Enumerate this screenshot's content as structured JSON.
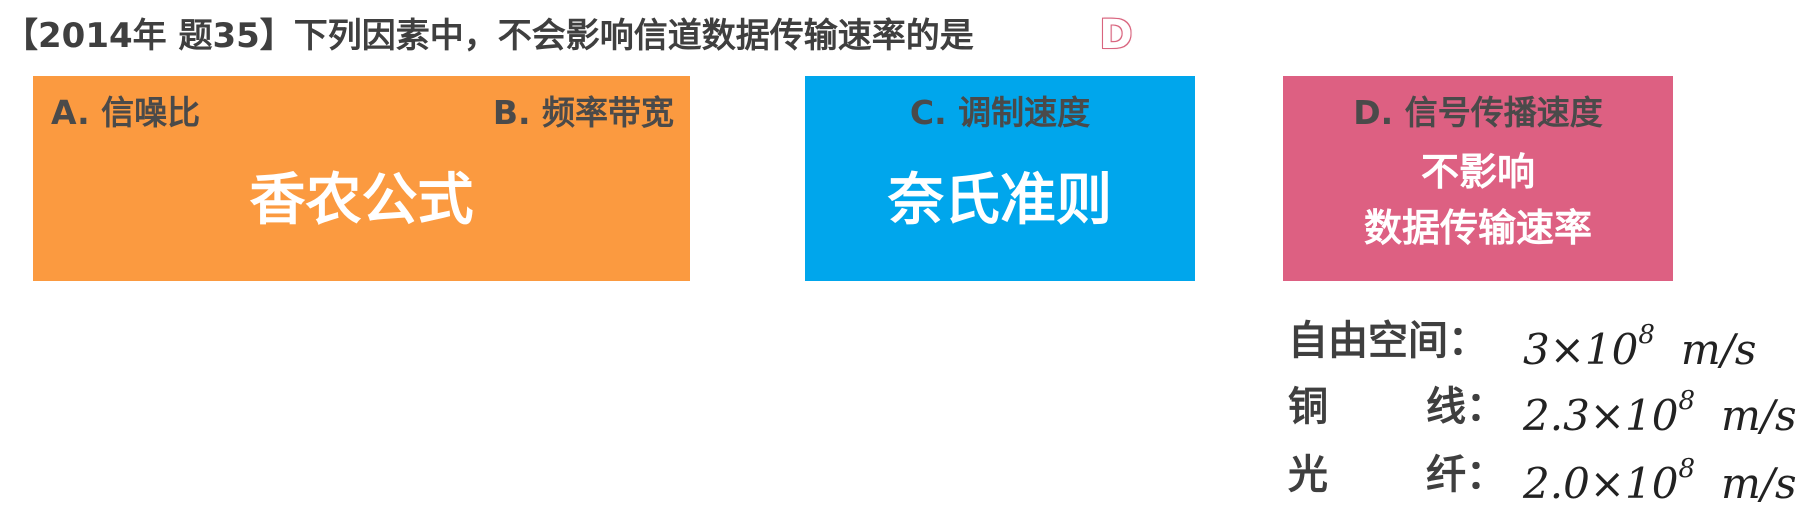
{
  "question": {
    "title": "【2014年 题35】下列因素中，不会影响信道数据传输速率的是",
    "answer": "D"
  },
  "colors": {
    "orange_box": "#fb9a40",
    "blue_box": "#00a6ec",
    "pink_box": "#dd6082",
    "answer_accent": "#d9657f"
  },
  "boxes": {
    "ab": {
      "option_a": "A. 信噪比",
      "option_b": "B. 频率带宽",
      "concept": "香农公式"
    },
    "c": {
      "option": "C. 调制速度",
      "concept": "奈氏准则"
    },
    "d": {
      "option": "D. 信号传播速度",
      "note_line1": "不影响",
      "note_line2": "数据传输速率"
    }
  },
  "speeds": [
    {
      "label": "自由空间：",
      "mantissa": "3×10",
      "exponent": "8",
      "unit": "m/s"
    },
    {
      "label_c1": "铜",
      "label_c2": "线：",
      "mantissa": "2.3×10",
      "exponent": "8",
      "unit": "m/s"
    },
    {
      "label_c1": "光",
      "label_c2": "纤：",
      "mantissa": "2.0×10",
      "exponent": "8",
      "unit": "m/s"
    }
  ]
}
